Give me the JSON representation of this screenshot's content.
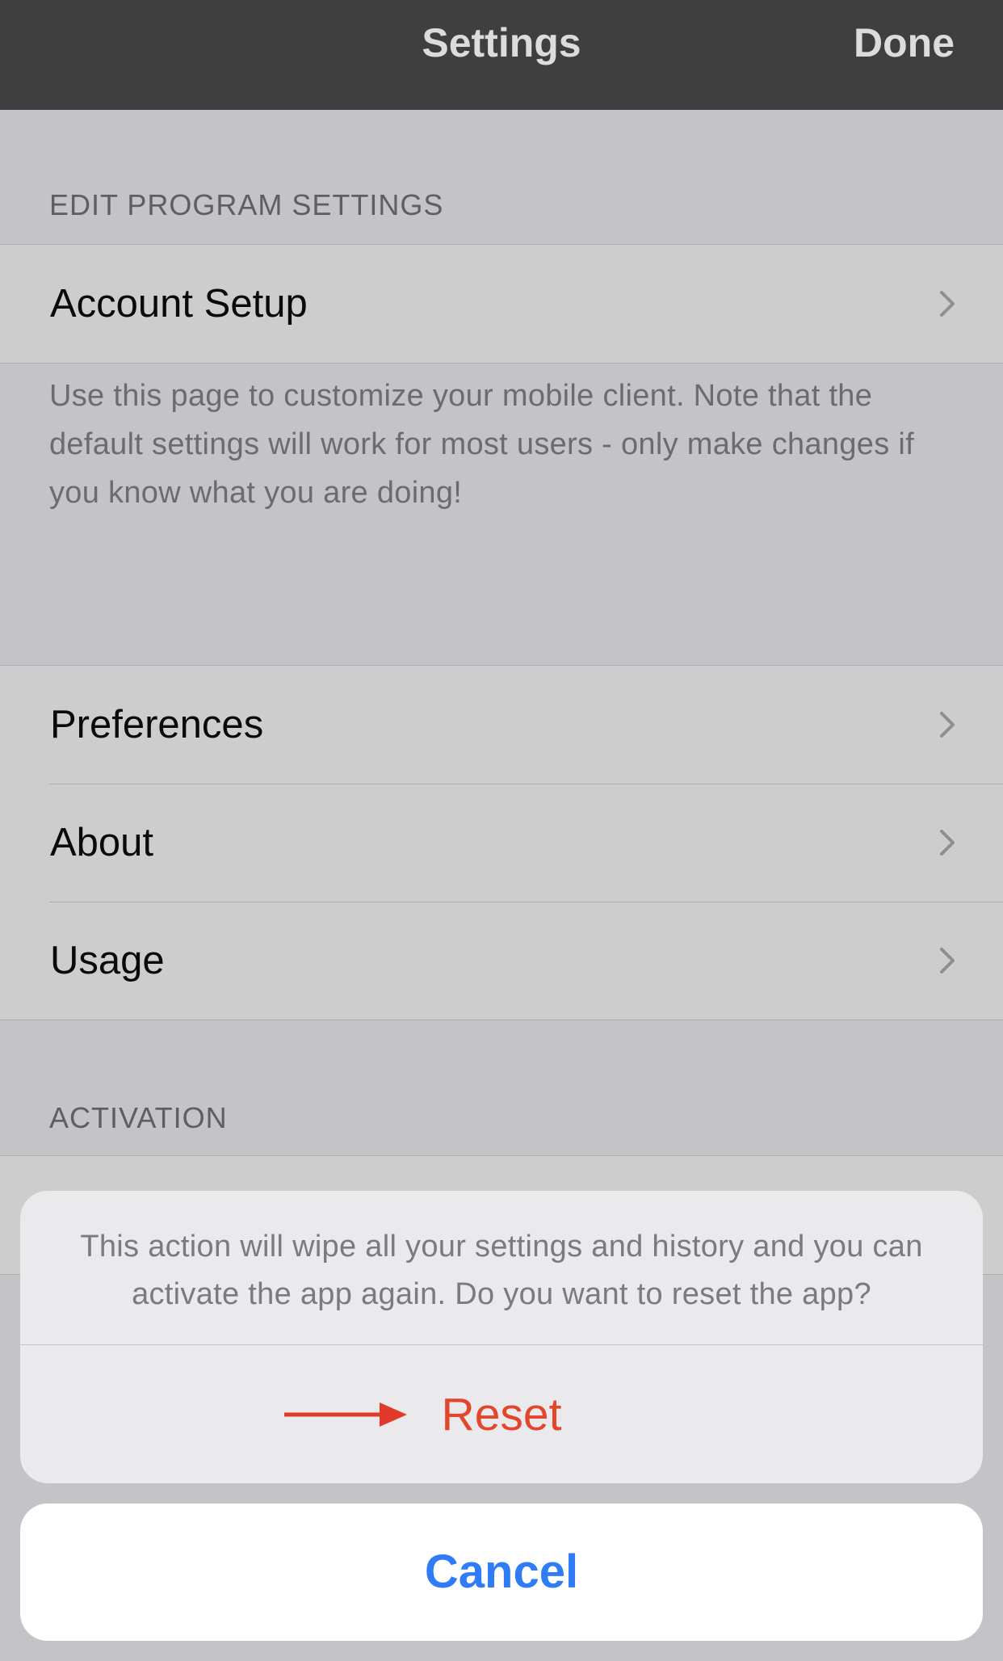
{
  "nav": {
    "title": "Settings",
    "done_label": "Done"
  },
  "sections": {
    "edit_program_settings": {
      "header": "EDIT PROGRAM SETTINGS",
      "items": [
        {
          "label": "Account Setup",
          "icon": "chevron-right-icon"
        }
      ],
      "footer": "Use this page to customize your mobile client. Note that the default settings will work for most users - only make changes if you know what you are doing!"
    },
    "general": {
      "items": [
        {
          "label": "Preferences",
          "icon": "chevron-right-icon"
        },
        {
          "label": "About",
          "icon": "chevron-right-icon"
        },
        {
          "label": "Usage",
          "icon": "chevron-right-icon"
        }
      ]
    },
    "activation": {
      "header": "ACTIVATION"
    }
  },
  "action_sheet": {
    "message": "This action will wipe all your settings and history and you can activate the app again. Do you want to reset the app?",
    "reset_label": "Reset",
    "cancel_label": "Cancel",
    "annotation_icon": "red-arrow-icon"
  },
  "colors": {
    "nav_background": "#3f3f3f",
    "page_background": "#c3c3c8",
    "destructive": "#e2462c",
    "accent": "#2f7cf6",
    "annotation_arrow": "#e23a2a"
  }
}
